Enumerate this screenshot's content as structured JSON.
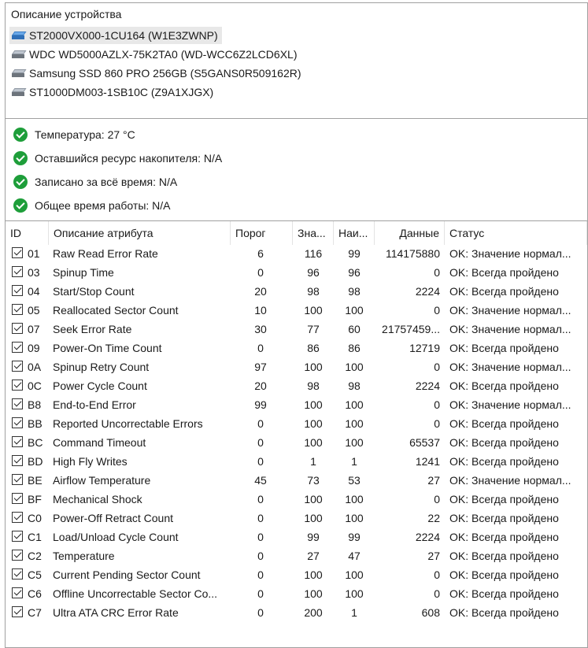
{
  "devices_panel": {
    "title": "Описание устройства",
    "devices": [
      {
        "label": "ST2000VX000-1CU164 (W1E3ZWNP)",
        "selected": true,
        "icon": "hdd-blue-icon"
      },
      {
        "label": "WDC WD5000AZLX-75K2TA0 (WD-WCC6Z2LCD6XL)",
        "selected": false,
        "icon": "hdd-icon"
      },
      {
        "label": "Samsung SSD 860 PRO 256GB (S5GANS0R509162R)",
        "selected": false,
        "icon": "hdd-icon"
      },
      {
        "label": "ST1000DM003-1SB10C (Z9A1XJGX)",
        "selected": false,
        "icon": "hdd-icon"
      }
    ]
  },
  "summary": {
    "items": [
      {
        "label": "Температура: 27 °C"
      },
      {
        "label": "Оставшийся ресурс накопителя: N/A"
      },
      {
        "label": "Записано за всё время: N/A"
      },
      {
        "label": "Общее время работы: N/A"
      }
    ],
    "status_color": "#1e9e3a"
  },
  "table": {
    "columns": {
      "id": "ID",
      "desc": "Описание атрибута",
      "threshold": "Порог",
      "value": "Зна...",
      "worst": "Наи...",
      "data": "Данные",
      "status": "Статус"
    },
    "rows": [
      {
        "id": "01",
        "desc": "Raw Read Error Rate",
        "threshold": "6",
        "value": "116",
        "worst": "99",
        "data": "114175880",
        "status": "OK: Значение нормал..."
      },
      {
        "id": "03",
        "desc": "Spinup Time",
        "threshold": "0",
        "value": "96",
        "worst": "96",
        "data": "0",
        "status": "OK: Всегда пройдено"
      },
      {
        "id": "04",
        "desc": "Start/Stop Count",
        "threshold": "20",
        "value": "98",
        "worst": "98",
        "data": "2224",
        "status": "OK: Всегда пройдено"
      },
      {
        "id": "05",
        "desc": "Reallocated Sector Count",
        "threshold": "10",
        "value": "100",
        "worst": "100",
        "data": "0",
        "status": "OK: Значение нормал..."
      },
      {
        "id": "07",
        "desc": "Seek Error Rate",
        "threshold": "30",
        "value": "77",
        "worst": "60",
        "data": "21757459...",
        "status": "OK: Значение нормал..."
      },
      {
        "id": "09",
        "desc": "Power-On Time Count",
        "threshold": "0",
        "value": "86",
        "worst": "86",
        "data": "12719",
        "status": "OK: Всегда пройдено"
      },
      {
        "id": "0A",
        "desc": "Spinup Retry Count",
        "threshold": "97",
        "value": "100",
        "worst": "100",
        "data": "0",
        "status": "OK: Значение нормал..."
      },
      {
        "id": "0C",
        "desc": "Power Cycle Count",
        "threshold": "20",
        "value": "98",
        "worst": "98",
        "data": "2224",
        "status": "OK: Всегда пройдено"
      },
      {
        "id": "B8",
        "desc": "End-to-End Error",
        "threshold": "99",
        "value": "100",
        "worst": "100",
        "data": "0",
        "status": "OK: Значение нормал..."
      },
      {
        "id": "BB",
        "desc": "Reported Uncorrectable Errors",
        "threshold": "0",
        "value": "100",
        "worst": "100",
        "data": "0",
        "status": "OK: Всегда пройдено"
      },
      {
        "id": "BC",
        "desc": "Command Timeout",
        "threshold": "0",
        "value": "100",
        "worst": "100",
        "data": "65537",
        "status": "OK: Всегда пройдено"
      },
      {
        "id": "BD",
        "desc": "High Fly Writes",
        "threshold": "0",
        "value": "1",
        "worst": "1",
        "data": "1241",
        "status": "OK: Всегда пройдено"
      },
      {
        "id": "BE",
        "desc": "Airflow Temperature",
        "threshold": "45",
        "value": "73",
        "worst": "53",
        "data": "27",
        "status": "OK: Значение нормал..."
      },
      {
        "id": "BF",
        "desc": "Mechanical Shock",
        "threshold": "0",
        "value": "100",
        "worst": "100",
        "data": "0",
        "status": "OK: Всегда пройдено"
      },
      {
        "id": "C0",
        "desc": "Power-Off Retract Count",
        "threshold": "0",
        "value": "100",
        "worst": "100",
        "data": "22",
        "status": "OK: Всегда пройдено"
      },
      {
        "id": "C1",
        "desc": "Load/Unload Cycle Count",
        "threshold": "0",
        "value": "99",
        "worst": "99",
        "data": "2224",
        "status": "OK: Всегда пройдено"
      },
      {
        "id": "C2",
        "desc": "Temperature",
        "threshold": "0",
        "value": "27",
        "worst": "47",
        "data": "27",
        "status": "OK: Всегда пройдено"
      },
      {
        "id": "C5",
        "desc": "Current Pending Sector Count",
        "threshold": "0",
        "value": "100",
        "worst": "100",
        "data": "0",
        "status": "OK: Всегда пройдено"
      },
      {
        "id": "C6",
        "desc": "Offline Uncorrectable Sector Co...",
        "threshold": "0",
        "value": "100",
        "worst": "100",
        "data": "0",
        "status": "OK: Всегда пройдено"
      },
      {
        "id": "C7",
        "desc": "Ultra ATA CRC Error Rate",
        "threshold": "0",
        "value": "200",
        "worst": "1",
        "data": "608",
        "status": "OK: Всегда пройдено"
      }
    ]
  }
}
